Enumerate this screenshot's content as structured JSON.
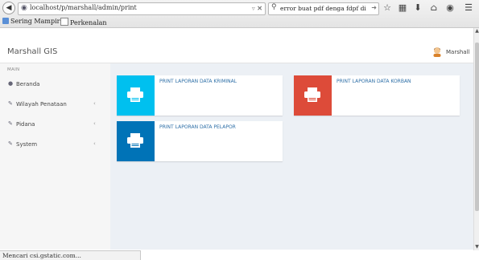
{
  "browser": {
    "url": "localhost/p/marshall/admin/print",
    "search_query": "error buat pdf denga fdpf di",
    "bookmarks": [
      "Sering Mampir",
      "Perkenalan"
    ],
    "status": "Mencari csi.gstatic.com..."
  },
  "header": {
    "brand": "Marshall GIS",
    "user": "Marshall"
  },
  "sidebar": {
    "section": "MAIN",
    "items": [
      {
        "label": "Beranda"
      },
      {
        "label": "Wilayah Penataan"
      },
      {
        "label": "Pidana"
      },
      {
        "label": "System"
      }
    ]
  },
  "cards": [
    {
      "label": "PRINT LAPORAN DATA KRIMINAL",
      "color": "#00c0ef"
    },
    {
      "label": "PRINT LAPORAN DATA KORBAN",
      "color": "#dd4b39"
    },
    {
      "label": "PRINT LAPORAN DATA PELAPOR",
      "color": "#0073b7"
    }
  ],
  "icons": {
    "back": "back-arrow-icon",
    "star": "star-icon",
    "library": "clipboard-icon",
    "download": "download-icon",
    "home": "home-icon",
    "chat": "chat-icon",
    "menu": "menu-icon",
    "printer": "printer-icon"
  }
}
